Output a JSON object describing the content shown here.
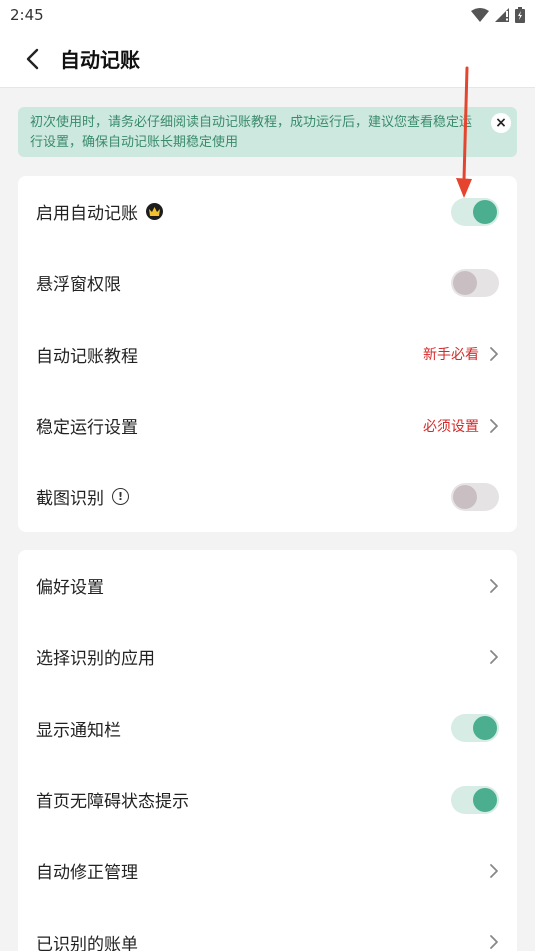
{
  "status_bar": {
    "time": "2:45"
  },
  "header": {
    "title": "自动记账"
  },
  "notice": {
    "text": "初次使用时，请务必仔细阅读自动记账教程，成功运行后，建议您查看稳定运行设置，确保自动记账长期稳定使用",
    "close": "×"
  },
  "sections": [
    {
      "items": [
        {
          "label": "启用自动记账",
          "badge": "crown-icon",
          "control": "toggle",
          "on": true
        },
        {
          "label": "悬浮窗权限",
          "control": "toggle",
          "on": false
        },
        {
          "label": "自动记账教程",
          "control": "link",
          "hint": "新手必看"
        },
        {
          "label": "稳定运行设置",
          "control": "link",
          "hint": "必须设置"
        },
        {
          "label": "截图识别",
          "badge": "info-icon",
          "badge_text": "!",
          "control": "toggle",
          "on": false
        }
      ]
    },
    {
      "items": [
        {
          "label": "偏好设置",
          "control": "link"
        },
        {
          "label": "选择识别的应用",
          "control": "link"
        },
        {
          "label": "显示通知栏",
          "control": "toggle",
          "on": true
        },
        {
          "label": "首页无障碍状态提示",
          "control": "toggle",
          "on": true
        },
        {
          "label": "自动修正管理",
          "control": "link"
        },
        {
          "label": "已识别的账单",
          "control": "link"
        }
      ]
    }
  ],
  "colors": {
    "accent": "#4aae8f",
    "notice_bg": "#cde9df",
    "notice_text": "#3a8a6c",
    "hint_red": "#d42a2a",
    "annotation_arrow": "#e5452f"
  }
}
